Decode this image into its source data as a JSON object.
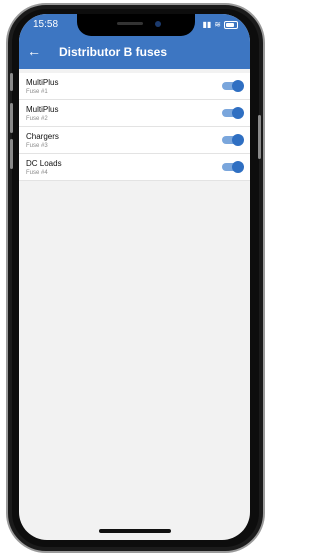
{
  "status_bar": {
    "time": "15:58",
    "signal": "📶",
    "wifi": "≋"
  },
  "header": {
    "back_icon": "←",
    "title": "Distributor B fuses"
  },
  "colors": {
    "header": "#3d76c2",
    "toggle_on": "#2f6fc2"
  },
  "fuses": [
    {
      "name": "MultiPlus",
      "label": "Fuse #1",
      "enabled": true
    },
    {
      "name": "MultiPlus",
      "label": "Fuse #2",
      "enabled": true
    },
    {
      "name": "Chargers",
      "label": "Fuse #3",
      "enabled": true
    },
    {
      "name": "DC Loads",
      "label": "Fuse #4",
      "enabled": true
    }
  ]
}
